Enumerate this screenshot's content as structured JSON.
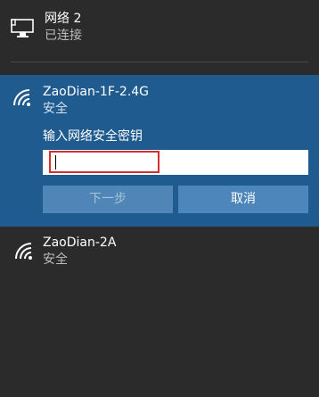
{
  "ethernet": {
    "name": "网络 2",
    "status": "已连接",
    "icon": "ethernet-icon"
  },
  "selected_network": {
    "name": "ZaoDian-1F-2.4G",
    "security": "安全",
    "icon": "wifi-icon",
    "password_label": "输入网络安全密钥",
    "password_value": "",
    "password_placeholder": "",
    "next_button": "下一步",
    "cancel_button": "取消"
  },
  "networks": [
    {
      "name": "ZaoDian-2A",
      "security": "安全",
      "icon": "wifi-icon"
    }
  ],
  "colors": {
    "background": "#2b2b2b",
    "selected_background": "#1f5b8f",
    "button_background": "#4d86ba",
    "disabled_text": "#a9c3da",
    "input_focus_border": "#d32f2f"
  }
}
